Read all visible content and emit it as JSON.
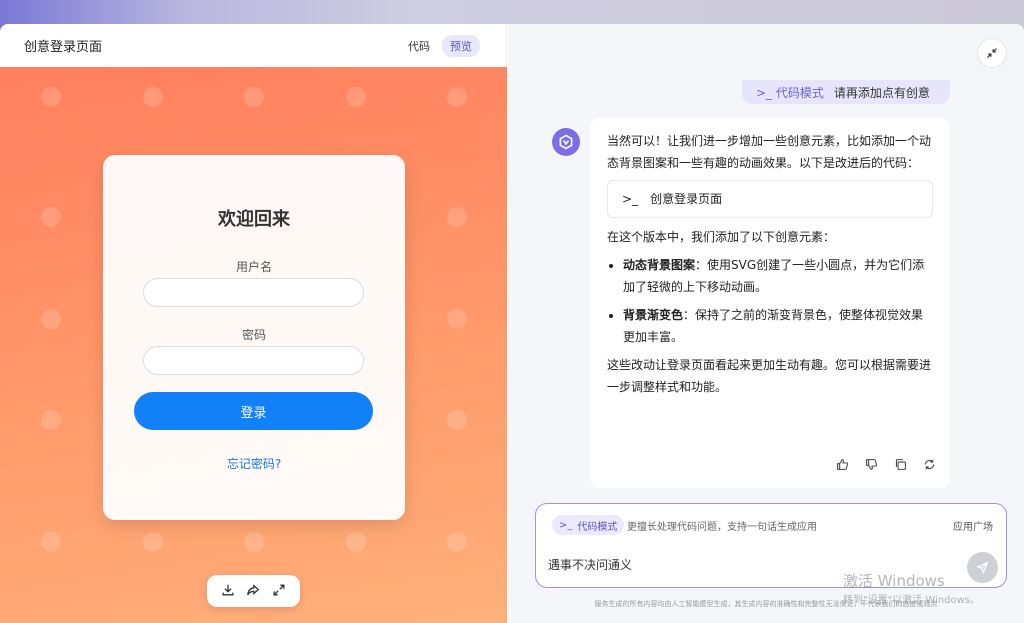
{
  "left": {
    "title": "创意登录页面",
    "tabs": [
      "代码",
      "预览"
    ],
    "login_card": {
      "heading": "欢迎回来",
      "username_label": "用户名",
      "password_label": "密码",
      "login_button": "登录",
      "forgot_link": "忘记密码?"
    },
    "toolbar_icons": [
      "download-icon",
      "share-icon",
      "expand-icon"
    ]
  },
  "right": {
    "user_message": {
      "mode": "代码模式",
      "text": "请再添加点有创意"
    },
    "bot_message": {
      "intro": "当然可以！让我们进一步增加一些创意元素，比如添加一个动态背景图案和一些有趣的动画效果。以下是改进后的代码：",
      "code_card_label": "创意登录页面",
      "summary_lead": "在这个版本中，我们添加了以下创意元素：",
      "bullets": [
        {
          "bold": "动态背景图案",
          "text": "：使用SVG创建了一些小圆点，并为它们添加了轻微的上下移动动画。"
        },
        {
          "bold": "背景渐变色",
          "text": "：保持了之前的渐变背景色，使整体视觉效果更加丰富。"
        }
      ],
      "closing": "这些改动让登录页面看起来更加生动有趣。您可以根据需要进一步调整样式和功能。"
    },
    "composer": {
      "mode_chip": "代码模式",
      "mode_hint": "更擅长处理代码问题，支持一句话生成应用",
      "app_plaza": "应用广场",
      "input_value": "遇事不决问通义"
    },
    "disclaimer": "服务生成的所有内容均由人工智能模型生成，其生成内容的准确性和完整性无法保证，不代表我们的态度或观点",
    "watermark": {
      "line1": "激活 Windows",
      "line2": "转到\"设置\"以激活 Windows。"
    }
  },
  "colors": {
    "accent": "#6a63d8",
    "primary_button": "#1280f7",
    "preview_gradient_start": "#ff7f5e",
    "preview_gradient_end": "#ffb07a"
  }
}
